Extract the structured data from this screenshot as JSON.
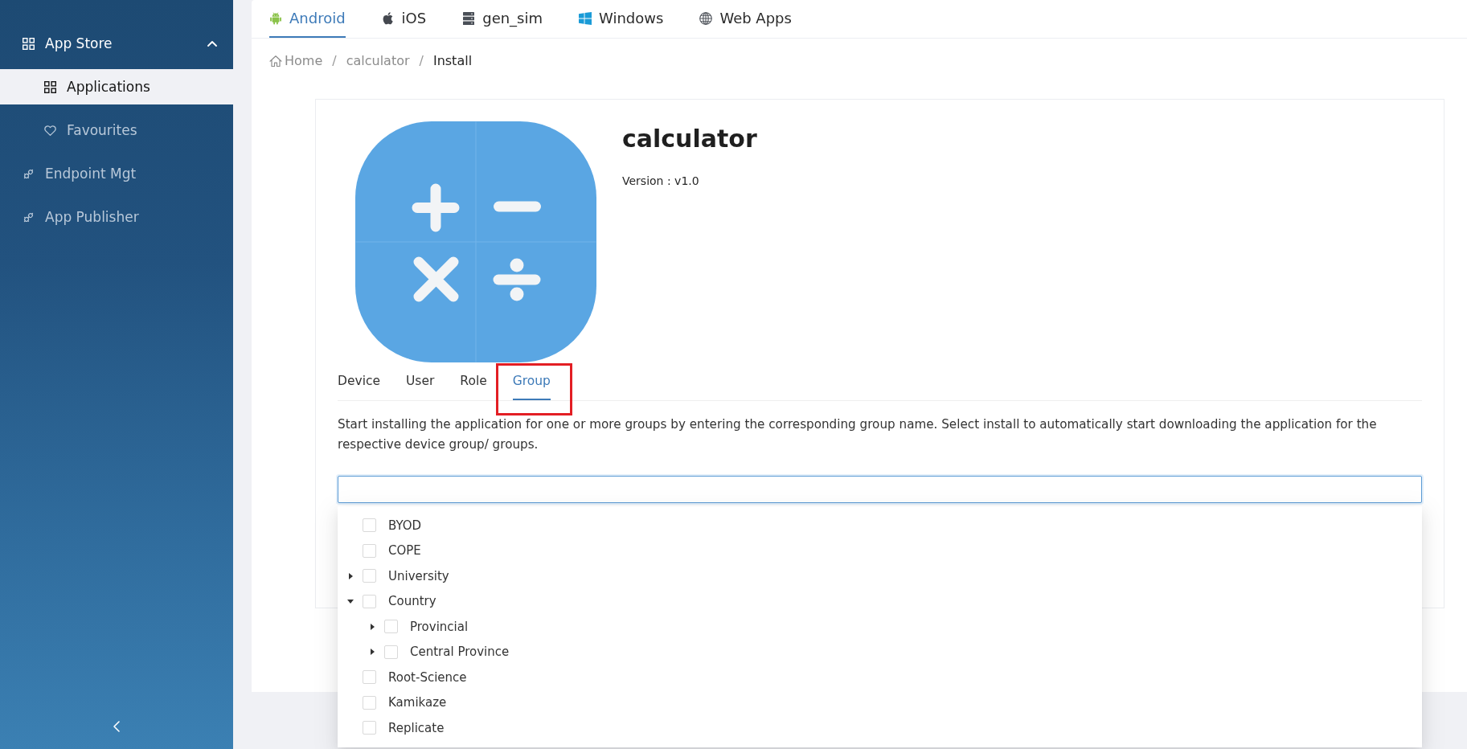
{
  "sidebar": {
    "items": [
      {
        "label": "App Store",
        "kind": "grid",
        "selected": false,
        "expanded": true,
        "children": [
          {
            "label": "Applications",
            "kind": "grid",
            "selected": true
          },
          {
            "label": "Favourites",
            "kind": "heart",
            "selected": false
          }
        ]
      },
      {
        "label": "Endpoint Mgt",
        "kind": "plug",
        "selected": false
      },
      {
        "label": "App Publisher",
        "kind": "plug",
        "selected": false
      }
    ]
  },
  "platform_tabs": [
    {
      "label": "Android",
      "kind": "android",
      "selected": true
    },
    {
      "label": "iOS",
      "kind": "apple",
      "selected": false
    },
    {
      "label": "gen_sim",
      "kind": "server",
      "selected": false
    },
    {
      "label": "Windows",
      "kind": "windows",
      "selected": false
    },
    {
      "label": "Web Apps",
      "kind": "globe",
      "selected": false
    }
  ],
  "breadcrumb": [
    {
      "label": "Home",
      "kind": "home",
      "current": false
    },
    {
      "label": "/",
      "kind": "separator"
    },
    {
      "label": "calculator",
      "kind": "link",
      "current": false
    },
    {
      "label": "/",
      "kind": "separator"
    },
    {
      "label": "Install",
      "kind": "link",
      "current": true
    }
  ],
  "app": {
    "title": "calculator",
    "version": "Version : v1.0"
  },
  "install_tabs": [
    {
      "label": "Device",
      "selected": false,
      "highlighted": false
    },
    {
      "label": "User",
      "selected": false,
      "highlighted": false
    },
    {
      "label": "Role",
      "selected": false,
      "highlighted": false
    },
    {
      "label": "Group",
      "selected": true,
      "highlighted": true
    }
  ],
  "group_install": {
    "description": "Start installing the application for one or more groups by entering the corresponding group name. Select install to automatically start downloading the application for the respective device group/ groups.",
    "field": {
      "focused": true
    },
    "tree": [
      {
        "label": "BYOD",
        "checked": false
      },
      {
        "label": "COPE",
        "checked": false
      },
      {
        "label": "University",
        "checked": false,
        "expanded": false
      },
      {
        "label": "Country",
        "checked": false,
        "expanded": true,
        "children": [
          {
            "label": "Provincial",
            "checked": false,
            "expanded": false
          },
          {
            "label": "Central Province",
            "checked": false,
            "expanded": false
          }
        ]
      },
      {
        "label": "Root-Science",
        "checked": false
      },
      {
        "label": "Kamikaze",
        "checked": false
      },
      {
        "label": "Replicate",
        "checked": false
      }
    ]
  }
}
